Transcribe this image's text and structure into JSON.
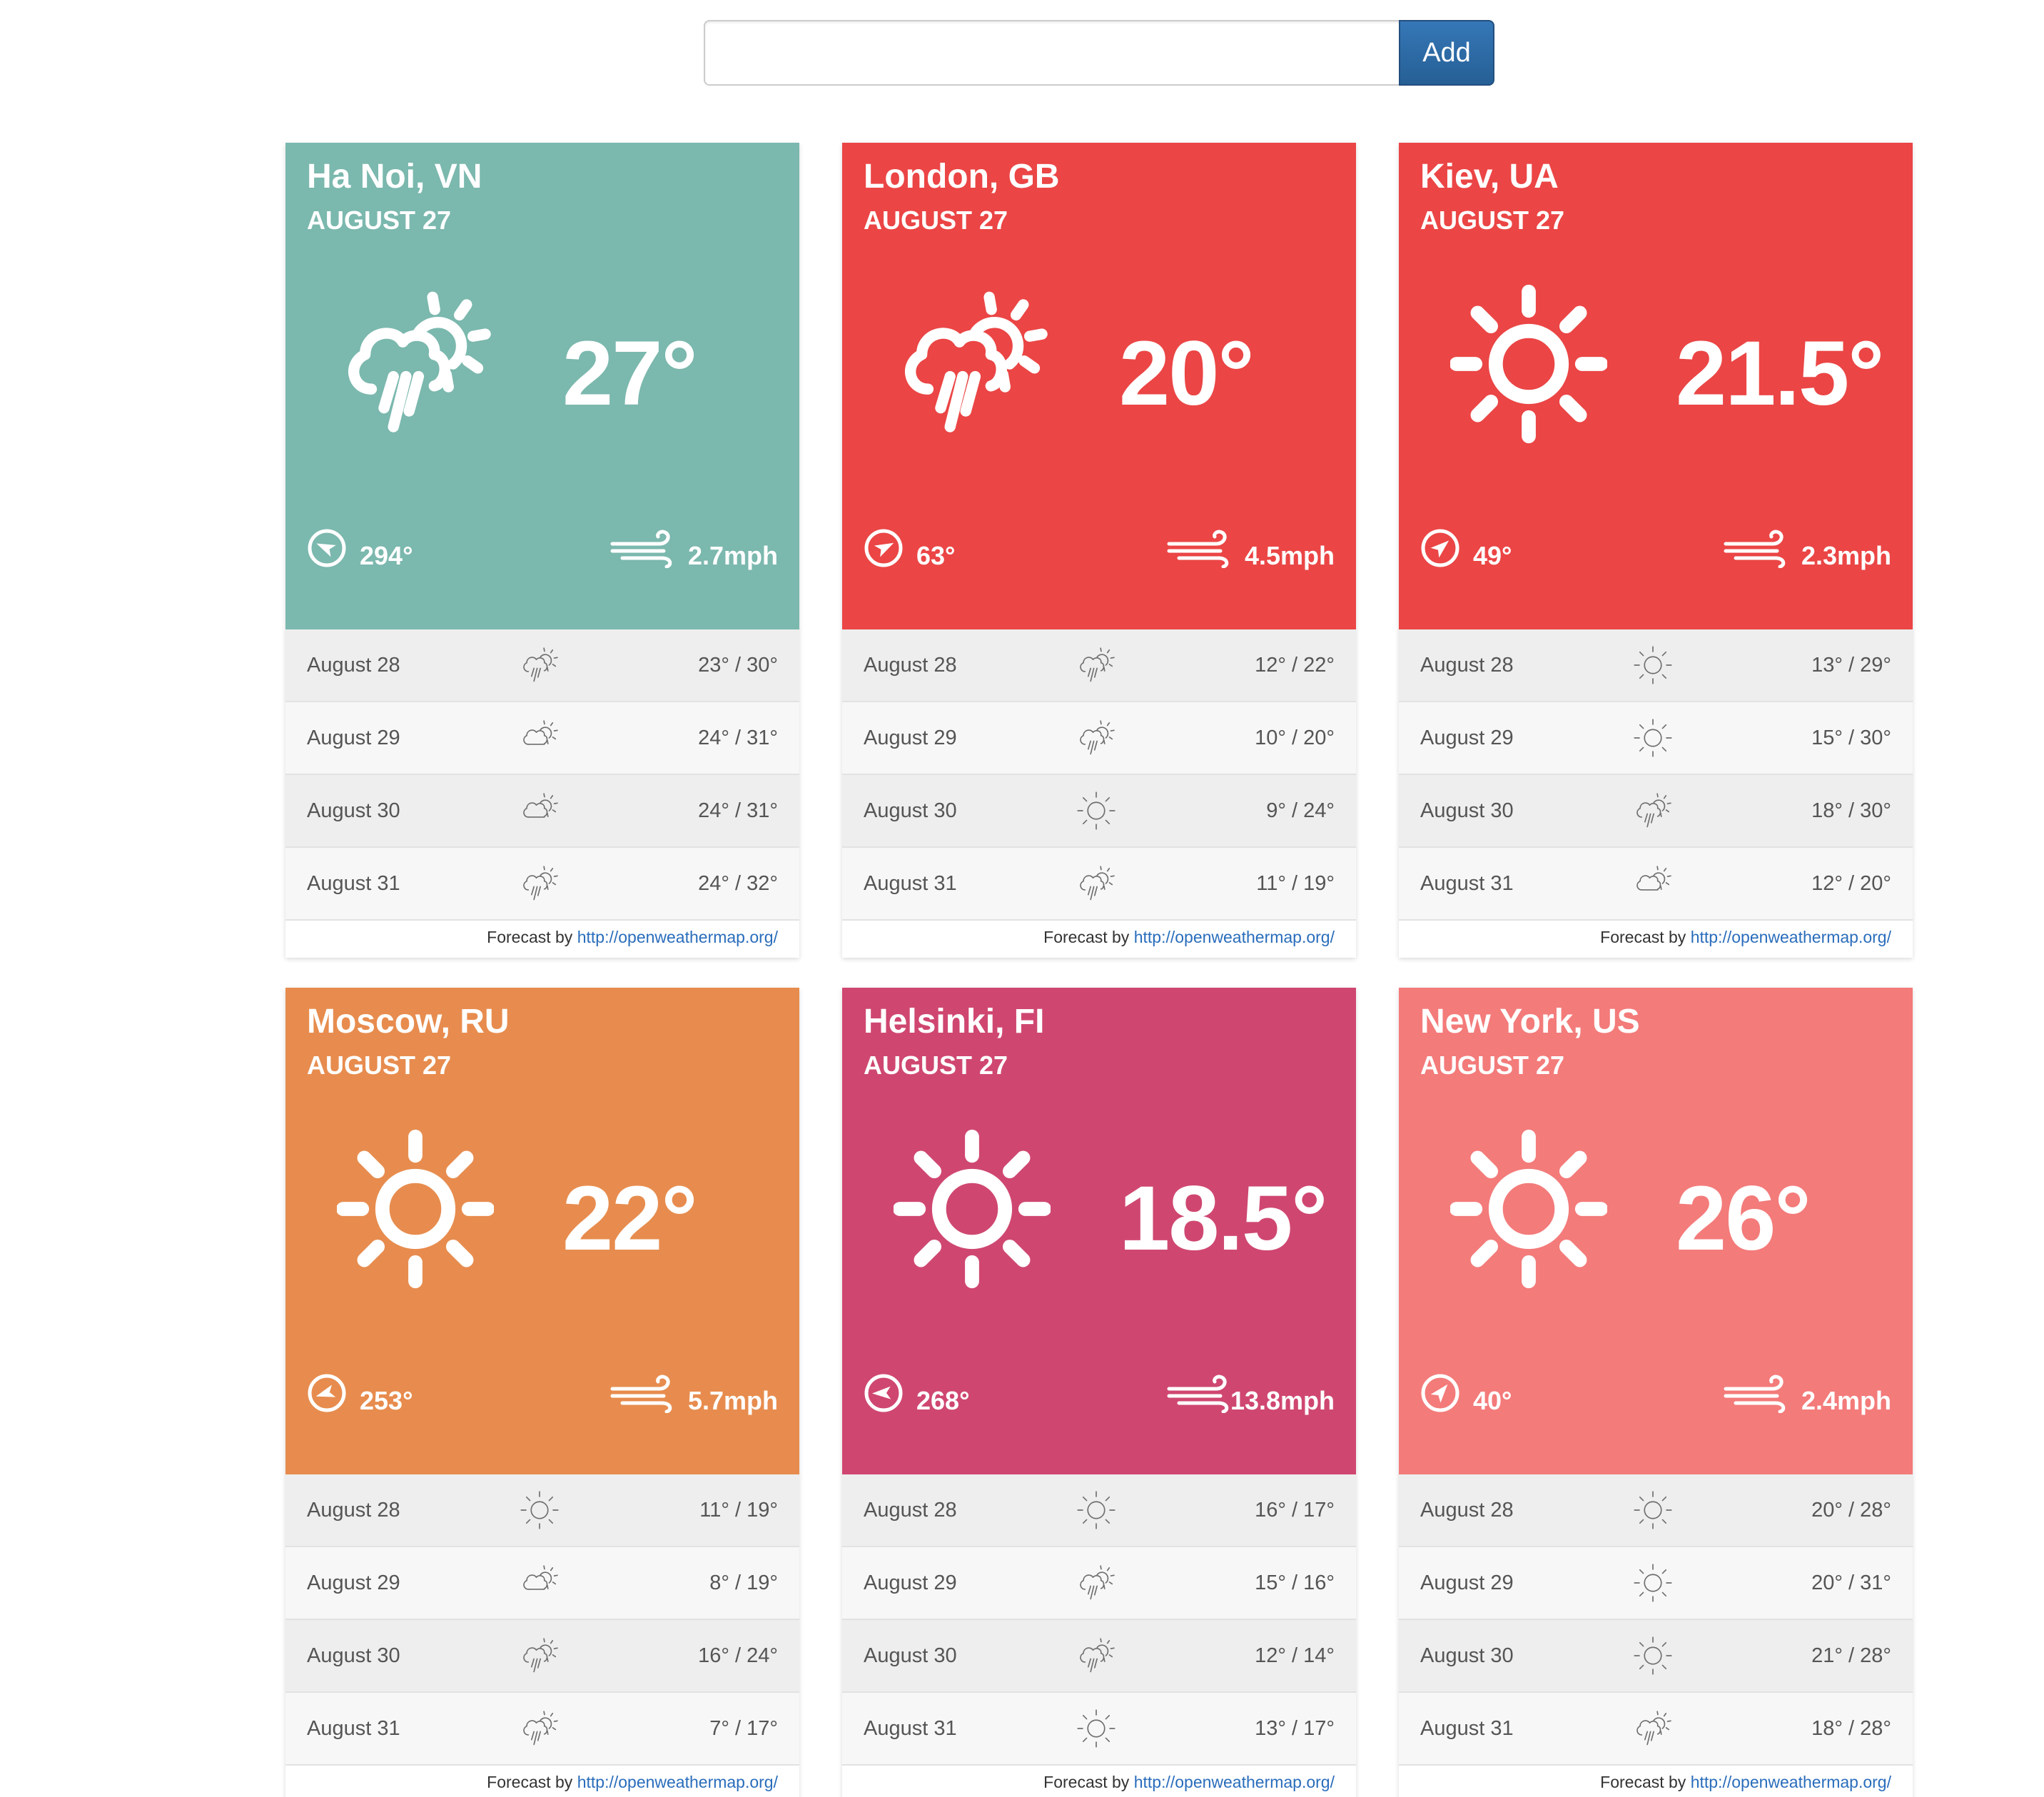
{
  "search": {
    "placeholder": "",
    "value": "",
    "add_label": "Add"
  },
  "colors": {
    "teal": "#7bb8ae",
    "red": "#eb4545",
    "orange": "#e78c4e",
    "magenta": "#cf4771",
    "salmon": "#f37b7a",
    "button": "#2c6aa6",
    "link": "#2a6dbb"
  },
  "credit": {
    "prefix": "Forecast by",
    "link": "http://openweathermap.org/"
  },
  "cards": [
    {
      "city": "Ha Noi, VN",
      "date": "AUGUST 27",
      "temp": "27°",
      "icon": "rain-sun-icon",
      "color": "#7bb8ae",
      "deg": "294°",
      "deg_value": 294,
      "wind": "2.7mph",
      "forecast": [
        {
          "date": "August 28",
          "icon": "rain-sun-icon",
          "range": "23° / 30°"
        },
        {
          "date": "August 29",
          "icon": "cloud-sun-icon",
          "range": "24° / 31°"
        },
        {
          "date": "August 30",
          "icon": "cloud-sun-icon",
          "range": "24° / 31°"
        },
        {
          "date": "August 31",
          "icon": "rain-sun-icon",
          "range": "24° / 32°"
        }
      ]
    },
    {
      "city": "London, GB",
      "date": "AUGUST 27",
      "temp": "20°",
      "icon": "rain-sun-icon",
      "color": "#eb4545",
      "deg": "63°",
      "deg_value": 63,
      "wind": "4.5mph",
      "forecast": [
        {
          "date": "August 28",
          "icon": "rain-sun-icon",
          "range": "12° / 22°"
        },
        {
          "date": "August 29",
          "icon": "rain-sun-icon",
          "range": "10° / 20°"
        },
        {
          "date": "August 30",
          "icon": "sun-icon",
          "range": "9° / 24°"
        },
        {
          "date": "August 31",
          "icon": "rain-sun-icon",
          "range": "11° / 19°"
        }
      ]
    },
    {
      "city": "Kiev, UA",
      "date": "AUGUST 27",
      "temp": "21.5°",
      "icon": "sun-icon",
      "color": "#eb4545",
      "deg": "49°",
      "deg_value": 49,
      "wind": "2.3mph",
      "forecast": [
        {
          "date": "August 28",
          "icon": "sun-icon",
          "range": "13° / 29°"
        },
        {
          "date": "August 29",
          "icon": "sun-icon",
          "range": "15° / 30°"
        },
        {
          "date": "August 30",
          "icon": "rain-sun-icon",
          "range": "18° / 30°"
        },
        {
          "date": "August 31",
          "icon": "cloud-sun-icon",
          "range": "12° / 20°"
        }
      ]
    },
    {
      "city": "Moscow, RU",
      "date": "AUGUST 27",
      "temp": "22°",
      "icon": "sun-icon",
      "color": "#e78c4e",
      "deg": "253°",
      "deg_value": 253,
      "wind": "5.7mph",
      "forecast": [
        {
          "date": "August 28",
          "icon": "sun-icon",
          "range": "11° / 19°"
        },
        {
          "date": "August 29",
          "icon": "cloud-sun-icon",
          "range": "8° / 19°"
        },
        {
          "date": "August 30",
          "icon": "rain-sun-icon",
          "range": "16° / 24°"
        },
        {
          "date": "August 31",
          "icon": "rain-sun-icon",
          "range": "7° / 17°"
        }
      ]
    },
    {
      "city": "Helsinki, FI",
      "date": "AUGUST 27",
      "temp": "18.5°",
      "icon": "sun-icon",
      "color": "#cf4771",
      "deg": "268°",
      "deg_value": 268,
      "wind": "13.8mph",
      "forecast": [
        {
          "date": "August 28",
          "icon": "sun-icon",
          "range": "16° / 17°"
        },
        {
          "date": "August 29",
          "icon": "rain-sun-icon",
          "range": "15° / 16°"
        },
        {
          "date": "August 30",
          "icon": "rain-sun-icon",
          "range": "12° / 14°"
        },
        {
          "date": "August 31",
          "icon": "sun-icon",
          "range": "13° / 17°"
        }
      ]
    },
    {
      "city": "New York, US",
      "date": "AUGUST 27",
      "temp": "26°",
      "icon": "sun-icon",
      "color": "#f37b7a",
      "deg": "40°",
      "deg_value": 40,
      "wind": "2.4mph",
      "forecast": [
        {
          "date": "August 28",
          "icon": "sun-icon",
          "range": "20° / 28°"
        },
        {
          "date": "August 29",
          "icon": "sun-icon",
          "range": "20° / 31°"
        },
        {
          "date": "August 30",
          "icon": "sun-icon",
          "range": "21° / 28°"
        },
        {
          "date": "August 31",
          "icon": "rain-sun-icon",
          "range": "18° / 28°"
        }
      ]
    }
  ]
}
